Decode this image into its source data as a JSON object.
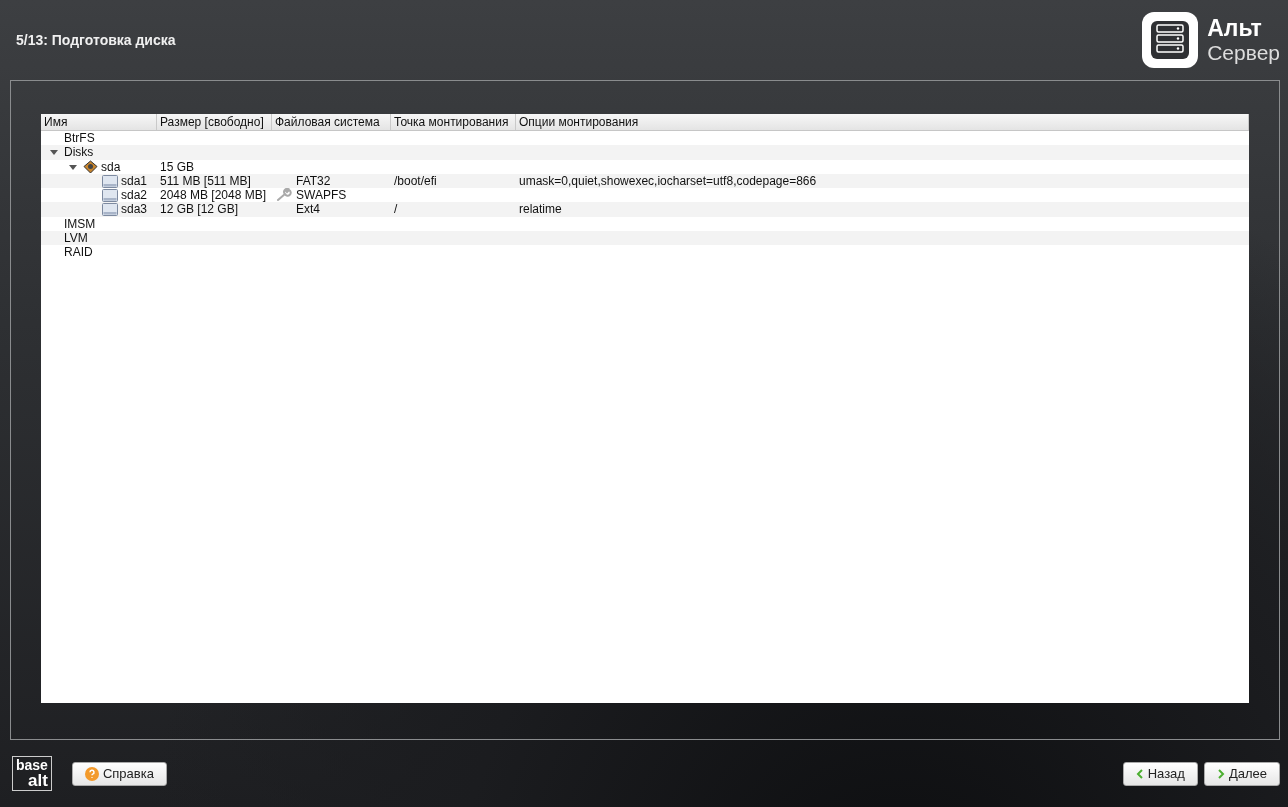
{
  "header": {
    "title": "5/13: Подготовка диска",
    "brand": {
      "name": "Альт",
      "product": "Сервер"
    }
  },
  "table": {
    "columns": [
      "Имя",
      "Размер [свободно]",
      "Файловая система",
      "Точка монтирования",
      "Опции монтирования"
    ],
    "rows": [
      {
        "name": "BtrFS"
      },
      {
        "name": "Disks",
        "expanded": true,
        "children": [
          {
            "name": "sda",
            "kind": "disk",
            "size": "15 GB",
            "expanded": true,
            "children": [
              {
                "name": "sda1",
                "kind": "partition",
                "size": "511 MB [511 MB]",
                "filesystem": "FAT32",
                "mount": "/boot/efi",
                "options": "umask=0,quiet,showexec,iocharset=utf8,codepage=866"
              },
              {
                "name": "sda2",
                "kind": "swap",
                "size": "2048 MB [2048 MB]",
                "filesystem": "SWAPFS"
              },
              {
                "name": "sda3",
                "kind": "partition",
                "size": "12 GB [12 GB]",
                "filesystem": "Ext4",
                "mount": "/",
                "options": "relatime"
              }
            ]
          }
        ]
      },
      {
        "name": "IMSM"
      },
      {
        "name": "LVM"
      },
      {
        "name": "RAID"
      }
    ]
  },
  "footer": {
    "logo": {
      "top": "base",
      "bottom": "alt"
    },
    "help_button": "Справка",
    "back_button": "Назад",
    "next_button": "Далее"
  }
}
